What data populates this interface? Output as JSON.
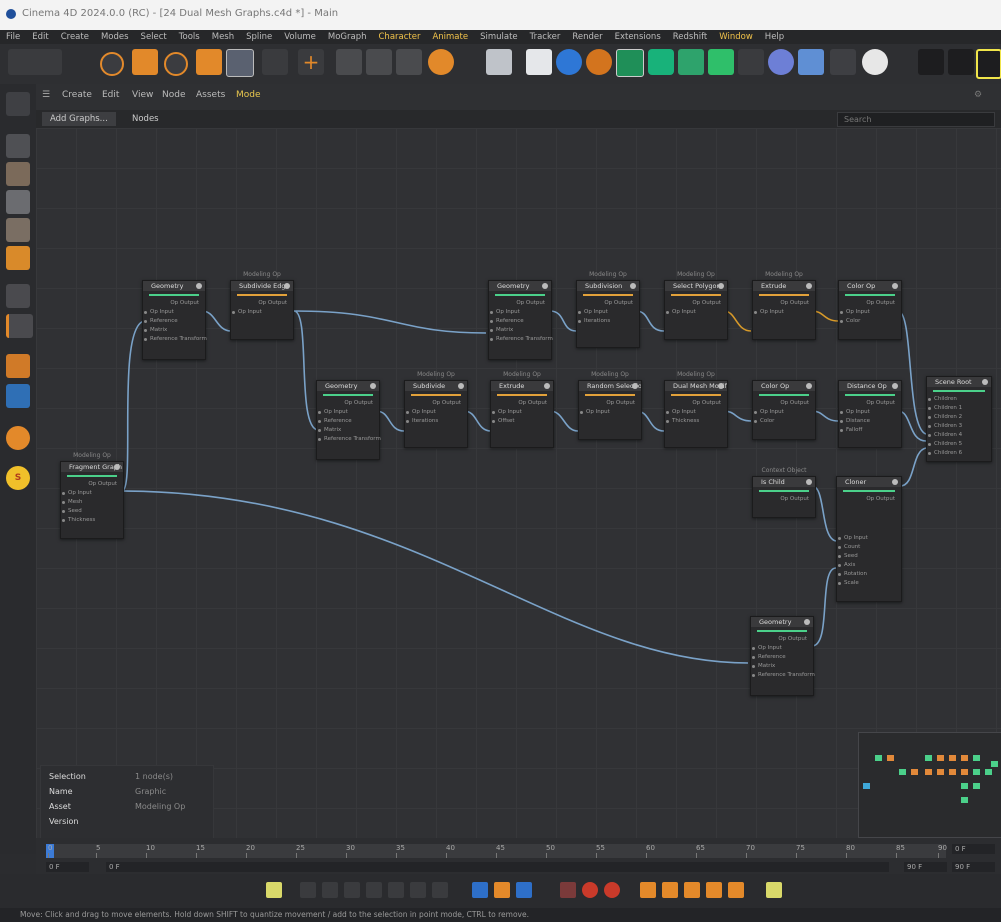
{
  "window": {
    "title": "Cinema 4D 2024.0.0 (RC) - [24 Dual Mesh Graphs.c4d *] - Main"
  },
  "menu": [
    "File",
    "Edit",
    "Create",
    "Modes",
    "Select",
    "Tools",
    "Mesh",
    "Spline",
    "Volume",
    "MoGraph",
    "Character",
    "Animate",
    "Simulate",
    "Tracker",
    "Render",
    "Extensions",
    "Redshift",
    "Window",
    "Help"
  ],
  "node_editor": {
    "menu": [
      "Create",
      "Edit",
      "View",
      "Node",
      "Assets",
      "Mode"
    ],
    "tabs": [
      "Add Graphs...",
      "Nodes"
    ],
    "search_placeholder": "Search"
  },
  "nodes": {
    "n1": {
      "title": "Geometry",
      "ports": [
        "Op Input",
        "Reference",
        "Matrix",
        "Reference Transform"
      ],
      "out": "Op Output"
    },
    "n2": {
      "caption": "Modeling Op",
      "title": "Subdivide Edge",
      "ports": [
        "Op Input"
      ],
      "out": "Op Output"
    },
    "n3": {
      "title": "Geometry",
      "ports": [
        "Op Input",
        "Reference",
        "Matrix",
        "Reference Transform"
      ],
      "out": "Op Output"
    },
    "n4": {
      "caption": "Modeling Op",
      "title": "Subdivision",
      "ports": [
        "Op Input",
        "Iterations"
      ],
      "out": "Op Output"
    },
    "n5": {
      "caption": "Modeling Op",
      "title": "Select Polygon",
      "ports": [
        "Op Input"
      ],
      "out": "Op Output"
    },
    "n6": {
      "caption": "Modeling Op",
      "title": "Extrude",
      "ports": [
        "Op Input"
      ],
      "out": "Op Output"
    },
    "n7": {
      "title": "Color Op",
      "ports": [
        "Op Input",
        "Color"
      ],
      "out": "Op Output"
    },
    "n8": {
      "title": "Geometry",
      "ports": [
        "Op Input",
        "Reference",
        "Matrix",
        "Reference Transform"
      ],
      "out": "Op Output"
    },
    "n9": {
      "caption": "Modeling Op",
      "title": "Subdivide",
      "ports": [
        "Op Input",
        "Iterations"
      ],
      "out": "Op Output"
    },
    "n10": {
      "caption": "Modeling Op",
      "title": "Extrude",
      "ports": [
        "Op Input",
        "Offset"
      ],
      "out": "Op Output"
    },
    "n11": {
      "caption": "Modeling Op",
      "title": "Random Selection",
      "ports": [
        "Op Input"
      ],
      "out": "Op Output"
    },
    "n12": {
      "caption": "Modeling Op",
      "title": "Dual Mesh Modifier",
      "ports": [
        "Op Input",
        "Thickness"
      ],
      "out": "Op Output"
    },
    "n13": {
      "title": "Color Op",
      "ports": [
        "Op Input",
        "Color"
      ],
      "out": "Op Output"
    },
    "n14": {
      "title": "Distance Op",
      "ports": [
        "Op Input",
        "Distance",
        "Falloff"
      ],
      "out": "Op Output"
    },
    "n15": {
      "title": "Scene Root",
      "ports": [
        "Children",
        "Children 1",
        "Children 2",
        "Children 3",
        "Children 4",
        "Children 5",
        "Children 6"
      ],
      "out": ""
    },
    "n16": {
      "caption": "Modeling Op",
      "title": "Fragment Graph",
      "ports": [
        "Op Input",
        "Mesh",
        "Seed",
        "Thickness"
      ],
      "out": "Op Output"
    },
    "n17": {
      "caption": "Context Object",
      "title": "Is Child",
      "ports": [],
      "out": "Op Output"
    },
    "n18": {
      "title": "Cloner",
      "ports": [
        "Op Input",
        "Count",
        "Seed",
        "Axis",
        "Rotation",
        "Scale"
      ],
      "out": "Op Output"
    },
    "n19": {
      "title": "Geometry",
      "ports": [
        "Op Input",
        "Reference",
        "Matrix",
        "Reference Transform"
      ],
      "out": "Op Output"
    }
  },
  "properties": {
    "rows": [
      {
        "key": "Selection",
        "value": "1 node(s)"
      },
      {
        "key": "Name",
        "value": "Graphic"
      },
      {
        "key": "Asset",
        "value": "Modeling Op"
      },
      {
        "key": "Version",
        "value": ""
      }
    ]
  },
  "timeline": {
    "ticks": [
      "0",
      "5",
      "10",
      "15",
      "20",
      "25",
      "30",
      "35",
      "40",
      "45",
      "50",
      "55",
      "60",
      "65",
      "70",
      "75",
      "80",
      "85",
      "90"
    ],
    "start": "0 F",
    "current": "0 F",
    "end": "90 F",
    "end2": "90 F",
    "fps_field": "0 F"
  },
  "status": "Move: Click and drag to move elements. Hold down SHIFT to quantize movement / add to the selection in point mode, CTRL to remove.",
  "colors": {
    "accent": "#f0c24a",
    "wire": "#7aa2c8",
    "wire_orange": "#d79a2a",
    "bar_green": "#4bd08a",
    "bar_orange": "#e2a13a"
  }
}
